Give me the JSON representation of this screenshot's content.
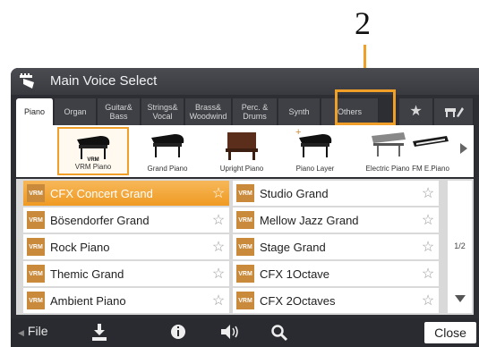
{
  "callout": {
    "number": "2"
  },
  "window": {
    "title": "Main Voice Select"
  },
  "tabs": [
    {
      "label": "Piano",
      "active": true
    },
    {
      "label": "Organ"
    },
    {
      "label": "Guitar&\nBass"
    },
    {
      "label": "Strings&\nVocal"
    },
    {
      "label": "Brass&\nWoodwind"
    },
    {
      "label": "Perc. &\nDrums"
    },
    {
      "label": "Synth"
    },
    {
      "label": "Others",
      "highlighted": true
    }
  ],
  "tab_icons": [
    "star-icon",
    "piano-user-edit-icon"
  ],
  "categories": [
    {
      "label": "VRM Piano",
      "badge": "VRM",
      "active": true,
      "icon": "grand-piano-icon"
    },
    {
      "label": "Grand Piano",
      "icon": "grand-piano-icon"
    },
    {
      "label": "Upright Piano",
      "icon": "upright-piano-icon"
    },
    {
      "label": "Piano Layer",
      "badge": "+",
      "icon": "grand-piano-icon"
    },
    {
      "label": "Electric Piano",
      "icon": "electric-piano-icon"
    },
    {
      "label": "FM E.Piano",
      "icon": "keyboard-icon"
    }
  ],
  "voices_left": [
    {
      "badge": "VRM",
      "name": "CFX Concert Grand",
      "selected": true
    },
    {
      "badge": "VRM",
      "name": "Bösendorfer Grand"
    },
    {
      "badge": "VRM",
      "name": "Rock Piano"
    },
    {
      "badge": "VRM",
      "name": "Themic Grand"
    },
    {
      "badge": "VRM",
      "name": "Ambient Piano"
    }
  ],
  "voices_right": [
    {
      "badge": "VRM",
      "name": "Studio Grand"
    },
    {
      "badge": "VRM",
      "name": "Mellow Jazz Grand"
    },
    {
      "badge": "VRM",
      "name": "Stage Grand"
    },
    {
      "badge": "VRM",
      "name": "CFX 1Octave"
    },
    {
      "badge": "VRM",
      "name": "CFX 2Octaves"
    }
  ],
  "pager": {
    "page": "1/2"
  },
  "bottom": {
    "file": "File",
    "close": "Close"
  },
  "colors": {
    "accent": "#f0a028",
    "selected": "#ef9a22",
    "badge": "#c98a3c"
  }
}
